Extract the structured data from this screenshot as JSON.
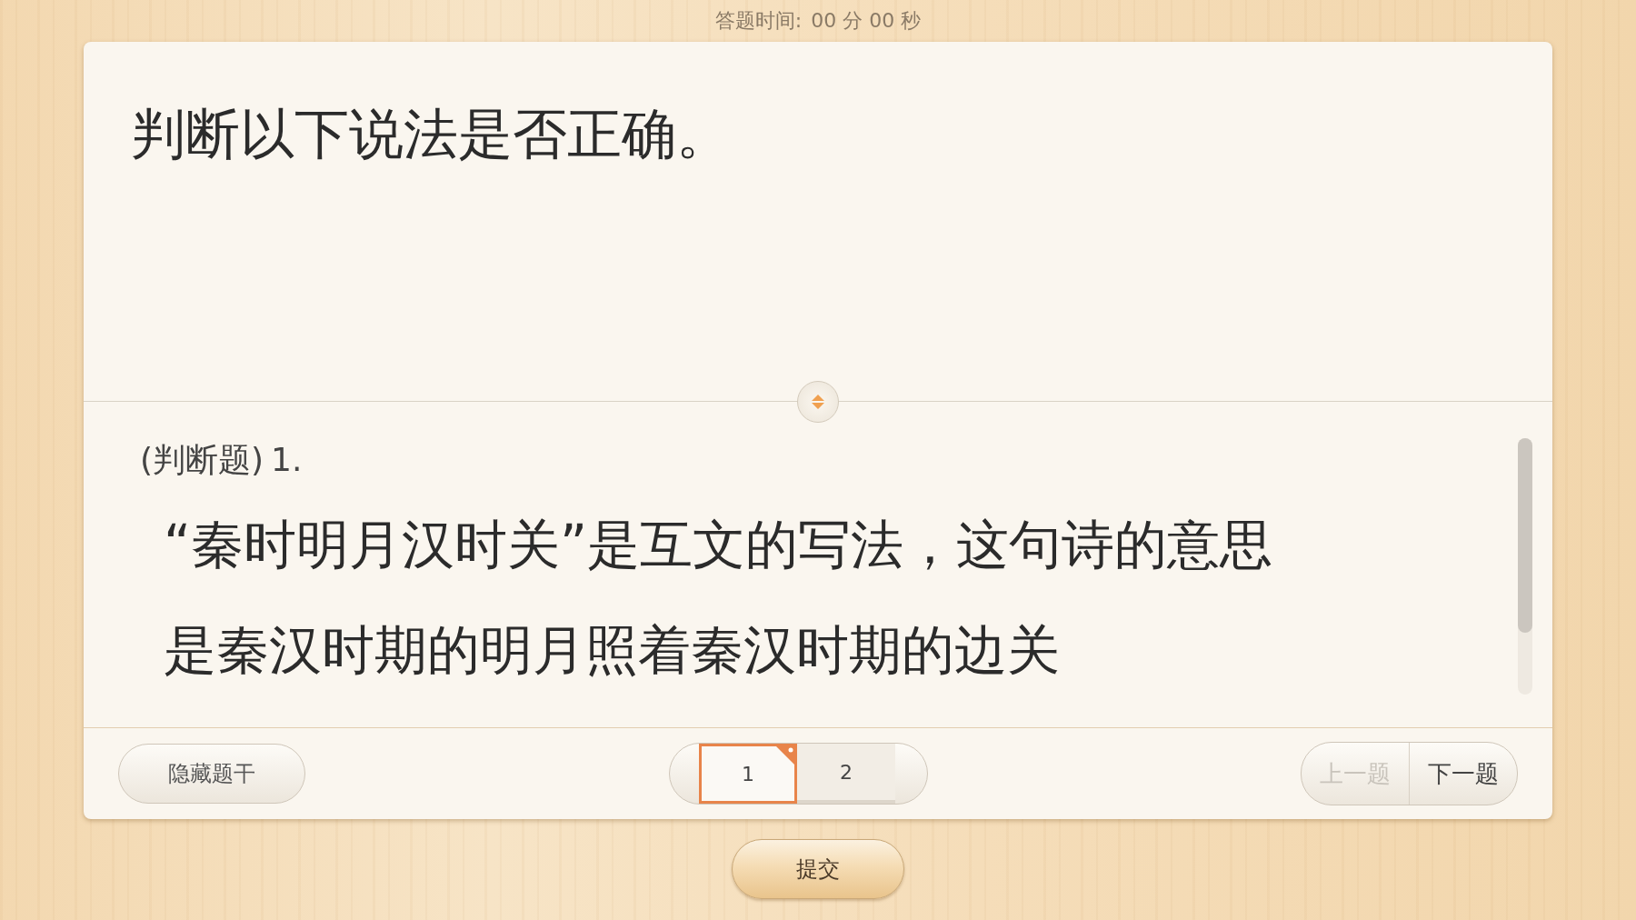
{
  "timer": {
    "label": "答题时间:",
    "minutes": "00",
    "minutes_unit": "分",
    "seconds": "00",
    "seconds_unit": "秒"
  },
  "stem": {
    "text": "判断以下说法是否正确。"
  },
  "question": {
    "type_label": "(判断题)",
    "number": "1.",
    "lines": [
      "“秦时明月汉时关”是互文的写法，这句诗的意思",
      "是秦汉时期的明月照着秦汉时期的边关"
    ]
  },
  "hide_stem_button": "隐藏题干",
  "pages": [
    {
      "label": "1",
      "selected": true,
      "flagged": true
    },
    {
      "label": "2",
      "selected": false,
      "flagged": false
    }
  ],
  "nav": [
    {
      "label": "上一题",
      "disabled": true
    },
    {
      "label": "下一题",
      "disabled": false
    }
  ],
  "submit_button": "提交"
}
